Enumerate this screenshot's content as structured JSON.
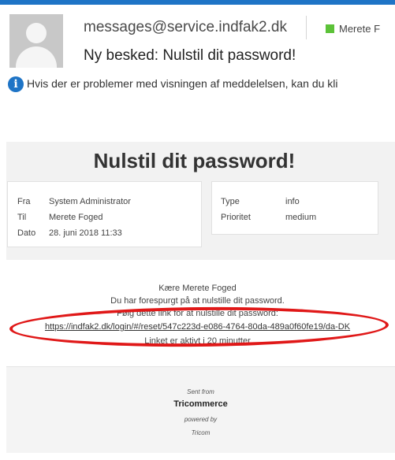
{
  "header": {
    "sender": "messages@service.indfak2.dk",
    "recipient": "Merete F",
    "subject": "Ny besked: Nulstil dit password!",
    "info_notice": "Hvis der er problemer med visningen af meddelelsen, kan du kli"
  },
  "mail": {
    "title": "Nulstil dit password!",
    "meta_left": [
      {
        "label": "Fra",
        "value": "System Administrator"
      },
      {
        "label": "Til",
        "value": "Merete Foged"
      },
      {
        "label": "Dato",
        "value": "28. juni 2018 11:33"
      }
    ],
    "meta_right": [
      {
        "label": "Type",
        "value": "info"
      },
      {
        "label": "Prioritet",
        "value": "medium"
      }
    ],
    "greeting": "Kære Merete Foged",
    "line1": "Du har forespurgt på at nulstille dit password.",
    "line2": "Følg dette link for at nulstille dit password:",
    "link": "https://indfak2.dk/login/#/reset/547c223d-e086-4764-80da-489a0f60fe19/da-DK",
    "line3": "Linket er aktivt i 20 minutter",
    "annotation_color": "#e01818"
  },
  "footer": {
    "sent_from": "Sent from",
    "brand": "Tricommerce",
    "powered_by": "powered by",
    "company": "Tricom"
  }
}
